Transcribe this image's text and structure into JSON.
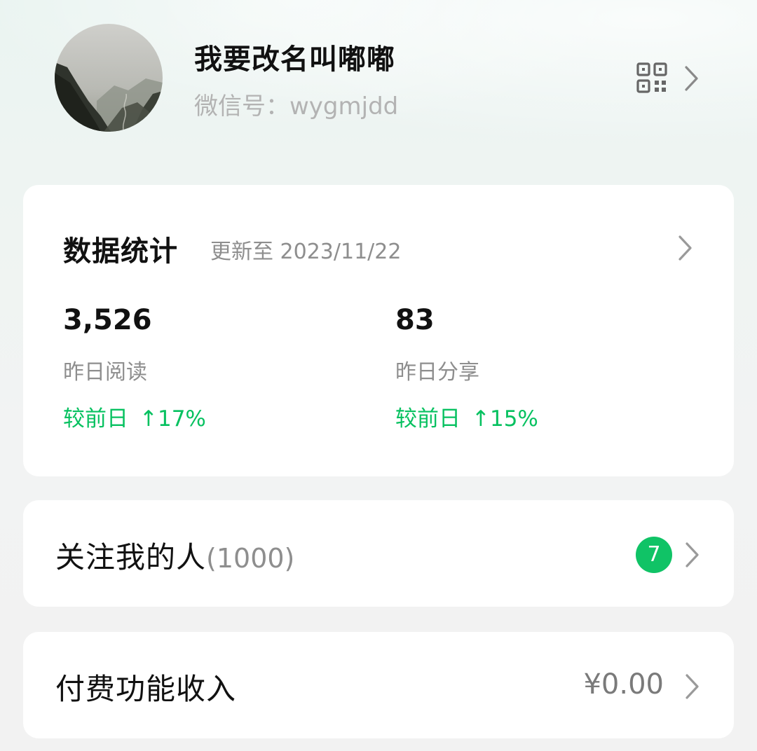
{
  "profile": {
    "nickname": "我要改名叫嘟嘟",
    "wechat_id_label": "微信号：wygmjdd",
    "qr_icon": "qr-code-icon",
    "chevron_icon": "chevron-right-icon"
  },
  "stats": {
    "title": "数据统计",
    "updated": "更新至 2023/11/22",
    "reads": {
      "value": "3,526",
      "label": "昨日阅读",
      "change_prefix": "较前日",
      "change": "↑17%"
    },
    "shares": {
      "value": "83",
      "label": "昨日分享",
      "change_prefix": "较前日",
      "change": "↑15%"
    }
  },
  "followers": {
    "label": "关注我的人",
    "count": "(1000)",
    "badge": "7"
  },
  "income": {
    "label": "付费功能收入",
    "value": "¥0.00"
  },
  "colors": {
    "accent_green": "#07c160",
    "badge_green": "#10c366",
    "muted_text": "#8e8e8e",
    "card_bg": "#ffffff"
  }
}
